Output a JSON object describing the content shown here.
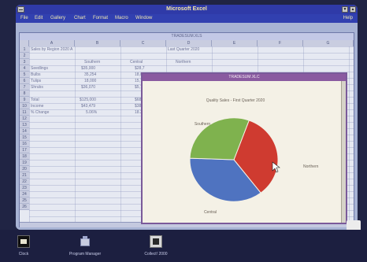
{
  "app": {
    "title": "Microsoft Excel",
    "menu": [
      "File",
      "Edit",
      "Gallery",
      "Chart",
      "Format",
      "Macro",
      "Window"
    ],
    "help": "Help"
  },
  "sheet": {
    "title": "TRADESUM.XLS",
    "columns": [
      "A",
      "B",
      "C",
      "D",
      "E",
      "F",
      "G"
    ],
    "rows": [
      "1",
      "2",
      "3",
      "4",
      "5",
      "6",
      "7",
      "8",
      "9",
      "10",
      "11",
      "12",
      "13",
      "14",
      "15",
      "16",
      "17",
      "18",
      "19",
      "20",
      "21",
      "22",
      "23",
      "24",
      "25",
      "26"
    ],
    "cells": {
      "a1": "Sales by Region 2020 A",
      "d1": "Last Quarter 2020",
      "b3": "Southern",
      "c3": "Central",
      "d3": "Northern",
      "a4": "Seedlings",
      "b4": "$35,000",
      "c4": "$28,7",
      "a5": "Bulbs",
      "b5": "35,254",
      "c5": "18,0",
      "a6": "Tulips",
      "b6": "18,000",
      "c6": "15,7",
      "a7": "Shrubs",
      "b7": "$36,070",
      "c7": "$5,7",
      "a9": "Total",
      "b9": "$125,000",
      "c9": "$68,7",
      "a10": "Income",
      "b10": "$43,479",
      "c10": "$38,6",
      "a11": "% Change",
      "b11": "5.06%",
      "c11": "18.3"
    }
  },
  "chart_window": {
    "title": "TRADESUM.XLC",
    "chart_data": {
      "type": "pie",
      "title": "Quality Sales - First Quarter 2020",
      "slices": [
        {
          "label": "Northern",
          "value": 34,
          "color": "#cf3b30"
        },
        {
          "label": "Central",
          "value": 36,
          "color": "#4f73c0"
        },
        {
          "label": "Southern",
          "value": 30,
          "color": "#7fb24e"
        }
      ]
    }
  },
  "taskbar": {
    "items": [
      {
        "label": "Clock",
        "icon": "clock-icon"
      },
      {
        "label": "Program Manager",
        "icon": "program-manager-icon"
      },
      {
        "label": "Collect! 2000",
        "icon": "collection-icon"
      }
    ]
  },
  "colors": {
    "titlebar": "#2f3aa8",
    "menubar": "#3140b0",
    "chart_titlebar": "#8a5aa0",
    "desktop": "#8fa0c8"
  }
}
